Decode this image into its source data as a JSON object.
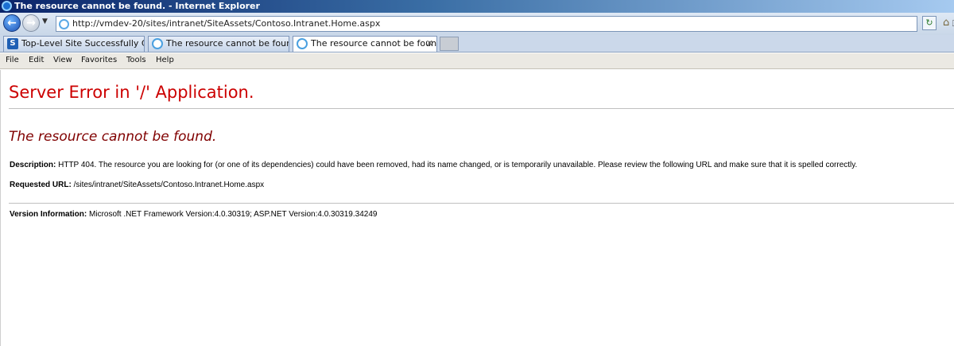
{
  "window": {
    "title": "The resource cannot be found. - Internet Explorer"
  },
  "address_bar": {
    "url": "http://vmdev-20/sites/intranet/SiteAssets/Contoso.Intranet.Home.aspx"
  },
  "tabs": [
    {
      "label": "Top-Level Site Successfully Cre...",
      "icon": "sharepoint-icon",
      "active": false
    },
    {
      "label": "The resource cannot be found.",
      "icon": "ie-page-icon",
      "active": false
    },
    {
      "label": "The resource cannot be found.",
      "icon": "ie-page-icon",
      "active": true,
      "close": "✕"
    }
  ],
  "menu": {
    "items": [
      "File",
      "Edit",
      "View",
      "Favorites",
      "Tools",
      "Help"
    ]
  },
  "page": {
    "server_error": "Server Error in '/' Application.",
    "resource_heading": "The resource cannot be found.",
    "description_label": "Description:",
    "description_text": " HTTP 404. The resource you are looking for (or one of its dependencies) could have been removed, had its name changed, or is temporarily unavailable.  Please review the following URL and make sure that it is spelled correctly.",
    "requested_url_label": "Requested URL:",
    "requested_url_text": " /sites/intranet/SiteAssets/Contoso.Intranet.Home.aspx",
    "version_label": "Version Information:",
    "version_text": " Microsoft .NET Framework Version:4.0.30319; ASP.NET Version:4.0.30319.34249"
  },
  "colors": {
    "error_red": "#cc0000",
    "heading_maroon": "#800000"
  }
}
